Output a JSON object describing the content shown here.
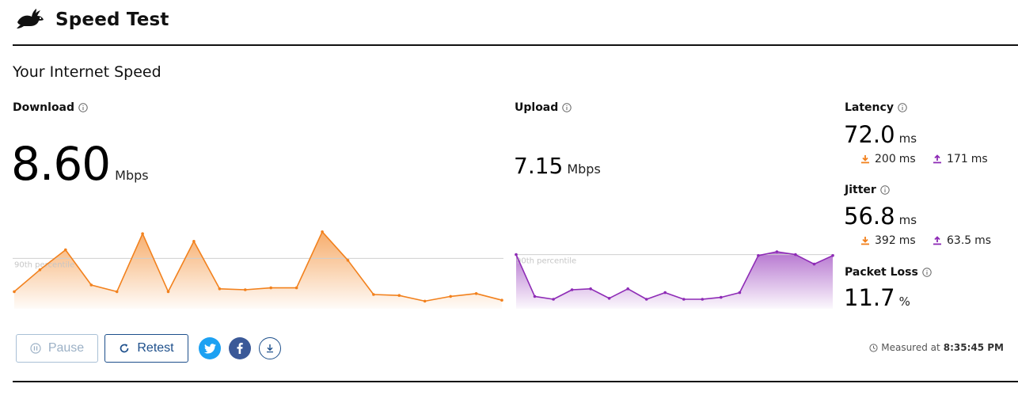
{
  "header": {
    "title": "Speed Test",
    "logo_icon": "rabbit-logo-icon"
  },
  "section_title": "Your Internet Speed",
  "download": {
    "label": "Download",
    "value": "8.60",
    "unit": "Mbps",
    "percentile_label": "90th percentile",
    "color": "#f2811d",
    "samples_mbps": [
      5.3,
      7.6,
      9.7,
      6.0,
      5.3,
      11.4,
      5.3,
      10.6,
      5.6,
      5.5,
      5.7,
      5.7,
      11.6,
      8.6,
      5.0,
      4.9,
      4.3,
      4.8,
      5.1,
      4.4
    ],
    "percentile_mbps": 8.8
  },
  "upload": {
    "label": "Upload",
    "value": "7.15",
    "unit": "Mbps",
    "percentile_label": "90th percentile",
    "color": "#8e2bb6",
    "samples_mbps": [
      9.2,
      4.8,
      4.5,
      5.5,
      5.6,
      4.6,
      5.6,
      4.5,
      5.2,
      4.5,
      4.5,
      4.7,
      5.2,
      9.1,
      9.5,
      9.2,
      8.2,
      9.1
    ],
    "percentile_mbps": 9.2
  },
  "latency": {
    "label": "Latency",
    "value": "72.0",
    "unit": "ms",
    "down": {
      "value": "200",
      "unit": "ms"
    },
    "up": {
      "value": "171",
      "unit": "ms"
    }
  },
  "jitter": {
    "label": "Jitter",
    "value": "56.8",
    "unit": "ms",
    "down": {
      "value": "392",
      "unit": "ms"
    },
    "up": {
      "value": "63.5",
      "unit": "ms"
    }
  },
  "packet_loss": {
    "label": "Packet Loss",
    "value": "11.7",
    "unit": "%"
  },
  "actions": {
    "pause_label": "Pause",
    "retest_label": "Retest",
    "share_icons": [
      "twitter-icon",
      "facebook-icon",
      "download-results-icon"
    ]
  },
  "measured": {
    "label": "Measured at",
    "time": "8:35:45 PM"
  },
  "colors": {
    "download": "#f2811d",
    "upload": "#8e2bb6",
    "accent": "#1d4f8b",
    "twitter": "#1da1f2",
    "facebook": "#3b5998"
  }
}
